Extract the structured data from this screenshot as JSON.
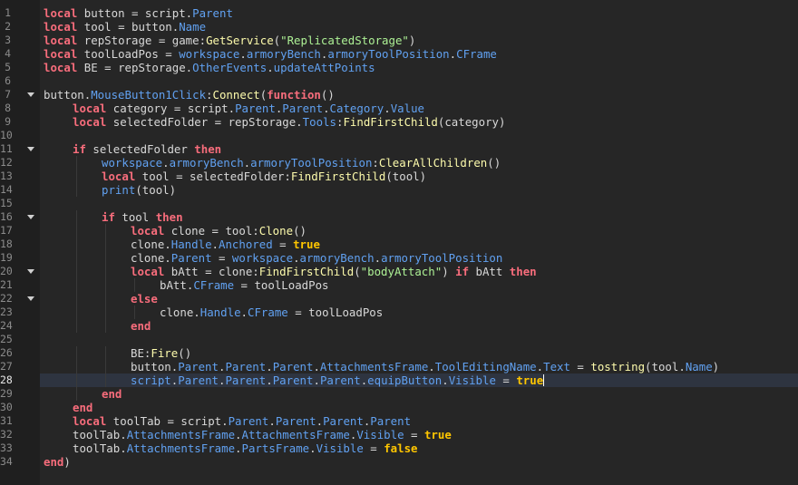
{
  "editor": {
    "current_line": 28,
    "colors": {
      "background": "#262626",
      "keyword": "#f86d7c",
      "property": "#61a1f1",
      "method": "#fdfbac",
      "string": "#adf195",
      "bool": "#ffc600",
      "text": "#d8d8d8"
    },
    "lines": [
      {
        "n": "1",
        "i": 0,
        "f": false,
        "segs": [
          [
            "k",
            "local"
          ],
          [
            "t",
            " button = script."
          ],
          [
            "p",
            "Parent"
          ]
        ]
      },
      {
        "n": "2",
        "i": 0,
        "f": false,
        "segs": [
          [
            "k",
            "local"
          ],
          [
            "t",
            " tool = button."
          ],
          [
            "p",
            "Name"
          ]
        ]
      },
      {
        "n": "3",
        "i": 0,
        "f": false,
        "segs": [
          [
            "k",
            "local"
          ],
          [
            "t",
            " repStorage = game:"
          ],
          [
            "m",
            "GetService"
          ],
          [
            "t",
            "("
          ],
          [
            "s",
            "\"ReplicatedStorage\""
          ],
          [
            "t",
            ")"
          ]
        ]
      },
      {
        "n": "4",
        "i": 0,
        "f": false,
        "segs": [
          [
            "k",
            "local"
          ],
          [
            "t",
            " toolLoadPos = "
          ],
          [
            "p",
            "workspace"
          ],
          [
            "t",
            "."
          ],
          [
            "p",
            "armoryBench"
          ],
          [
            "t",
            "."
          ],
          [
            "p",
            "armoryToolPosition"
          ],
          [
            "t",
            "."
          ],
          [
            "p",
            "CFrame"
          ]
        ]
      },
      {
        "n": "5",
        "i": 0,
        "f": false,
        "segs": [
          [
            "k",
            "local"
          ],
          [
            "t",
            " BE = repStorage."
          ],
          [
            "p",
            "OtherEvents"
          ],
          [
            "t",
            "."
          ],
          [
            "p",
            "updateAttPoints"
          ]
        ]
      },
      {
        "n": "6",
        "i": 0,
        "f": false,
        "segs": []
      },
      {
        "n": "7",
        "i": 0,
        "f": true,
        "segs": [
          [
            "t",
            "button."
          ],
          [
            "p",
            "MouseButton1Click"
          ],
          [
            "t",
            ":"
          ],
          [
            "m",
            "Connect"
          ],
          [
            "t",
            "("
          ],
          [
            "k",
            "function"
          ],
          [
            "t",
            "()"
          ]
        ]
      },
      {
        "n": "8",
        "i": 1,
        "f": false,
        "segs": [
          [
            "k",
            "local"
          ],
          [
            "t",
            " category = script."
          ],
          [
            "p",
            "Parent"
          ],
          [
            "t",
            "."
          ],
          [
            "p",
            "Parent"
          ],
          [
            "t",
            "."
          ],
          [
            "p",
            "Category"
          ],
          [
            "t",
            "."
          ],
          [
            "p",
            "Value"
          ]
        ]
      },
      {
        "n": "9",
        "i": 1,
        "f": false,
        "segs": [
          [
            "k",
            "local"
          ],
          [
            "t",
            " selectedFolder = repStorage."
          ],
          [
            "p",
            "Tools"
          ],
          [
            "t",
            ":"
          ],
          [
            "m",
            "FindFirstChild"
          ],
          [
            "t",
            "(category)"
          ]
        ]
      },
      {
        "n": "10",
        "i": 0,
        "f": false,
        "segs": []
      },
      {
        "n": "11",
        "i": 1,
        "f": true,
        "segs": [
          [
            "k",
            "if"
          ],
          [
            "t",
            " selectedFolder "
          ],
          [
            "k",
            "then"
          ]
        ]
      },
      {
        "n": "12",
        "i": 2,
        "f": false,
        "segs": [
          [
            "p",
            "workspace"
          ],
          [
            "t",
            "."
          ],
          [
            "p",
            "armoryBench"
          ],
          [
            "t",
            "."
          ],
          [
            "p",
            "armoryToolPosition"
          ],
          [
            "t",
            ":"
          ],
          [
            "m",
            "ClearAllChildren"
          ],
          [
            "t",
            "()"
          ]
        ]
      },
      {
        "n": "13",
        "i": 2,
        "f": false,
        "segs": [
          [
            "k",
            "local"
          ],
          [
            "t",
            " tool = selectedFolder:"
          ],
          [
            "m",
            "FindFirstChild"
          ],
          [
            "t",
            "(tool)"
          ]
        ]
      },
      {
        "n": "14",
        "i": 2,
        "f": false,
        "segs": [
          [
            "p",
            "print"
          ],
          [
            "t",
            "(tool)"
          ]
        ]
      },
      {
        "n": "15",
        "i": 0,
        "f": false,
        "segs": []
      },
      {
        "n": "16",
        "i": 2,
        "f": true,
        "segs": [
          [
            "k",
            "if"
          ],
          [
            "t",
            " tool "
          ],
          [
            "k",
            "then"
          ]
        ]
      },
      {
        "n": "17",
        "i": 3,
        "f": false,
        "segs": [
          [
            "k",
            "local"
          ],
          [
            "t",
            " clone = tool:"
          ],
          [
            "m",
            "Clone"
          ],
          [
            "t",
            "()"
          ]
        ]
      },
      {
        "n": "18",
        "i": 3,
        "f": false,
        "segs": [
          [
            "t",
            "clone."
          ],
          [
            "p",
            "Handle"
          ],
          [
            "t",
            "."
          ],
          [
            "p",
            "Anchored"
          ],
          [
            "t",
            " = "
          ],
          [
            "b",
            "true"
          ]
        ]
      },
      {
        "n": "19",
        "i": 3,
        "f": false,
        "segs": [
          [
            "t",
            "clone."
          ],
          [
            "p",
            "Parent"
          ],
          [
            "t",
            " = "
          ],
          [
            "p",
            "workspace"
          ],
          [
            "t",
            "."
          ],
          [
            "p",
            "armoryBench"
          ],
          [
            "t",
            "."
          ],
          [
            "p",
            "armoryToolPosition"
          ]
        ]
      },
      {
        "n": "20",
        "i": 3,
        "f": true,
        "segs": [
          [
            "k",
            "local"
          ],
          [
            "t",
            " bAtt = clone:"
          ],
          [
            "m",
            "FindFirstChild"
          ],
          [
            "t",
            "("
          ],
          [
            "s",
            "\"bodyAttach\""
          ],
          [
            "t",
            ") "
          ],
          [
            "k",
            "if"
          ],
          [
            "t",
            " bAtt "
          ],
          [
            "k",
            "then"
          ]
        ]
      },
      {
        "n": "21",
        "i": 4,
        "f": false,
        "segs": [
          [
            "t",
            "bAtt."
          ],
          [
            "p",
            "CFrame"
          ],
          [
            "t",
            " = toolLoadPos"
          ]
        ]
      },
      {
        "n": "22",
        "i": 3,
        "f": true,
        "segs": [
          [
            "k",
            "else"
          ]
        ]
      },
      {
        "n": "23",
        "i": 4,
        "f": false,
        "segs": [
          [
            "t",
            "clone."
          ],
          [
            "p",
            "Handle"
          ],
          [
            "t",
            "."
          ],
          [
            "p",
            "CFrame"
          ],
          [
            "t",
            " = toolLoadPos"
          ]
        ]
      },
      {
        "n": "24",
        "i": 3,
        "f": false,
        "segs": [
          [
            "k",
            "end"
          ]
        ]
      },
      {
        "n": "25",
        "i": 0,
        "f": false,
        "segs": []
      },
      {
        "n": "26",
        "i": 3,
        "f": false,
        "segs": [
          [
            "t",
            "BE:"
          ],
          [
            "m",
            "Fire"
          ],
          [
            "t",
            "()"
          ]
        ]
      },
      {
        "n": "27",
        "i": 3,
        "f": false,
        "segs": [
          [
            "t",
            "button."
          ],
          [
            "p",
            "Parent"
          ],
          [
            "t",
            "."
          ],
          [
            "p",
            "Parent"
          ],
          [
            "t",
            "."
          ],
          [
            "p",
            "Parent"
          ],
          [
            "t",
            "."
          ],
          [
            "p",
            "AttachmentsFrame"
          ],
          [
            "t",
            "."
          ],
          [
            "p",
            "ToolEditingName"
          ],
          [
            "t",
            "."
          ],
          [
            "p",
            "Text"
          ],
          [
            "t",
            " = "
          ],
          [
            "m",
            "tostring"
          ],
          [
            "t",
            "(tool."
          ],
          [
            "p",
            "Name"
          ],
          [
            "t",
            ")"
          ]
        ]
      },
      {
        "n": "28",
        "i": 3,
        "f": false,
        "segs": [
          [
            "p",
            "script"
          ],
          [
            "t",
            "."
          ],
          [
            "p",
            "Parent"
          ],
          [
            "t",
            "."
          ],
          [
            "p",
            "Parent"
          ],
          [
            "t",
            "."
          ],
          [
            "p",
            "Parent"
          ],
          [
            "t",
            "."
          ],
          [
            "p",
            "Parent"
          ],
          [
            "t",
            "."
          ],
          [
            "p",
            "equipButton"
          ],
          [
            "t",
            "."
          ],
          [
            "p",
            "Visible"
          ],
          [
            "t",
            " = "
          ],
          [
            "b",
            "true"
          ]
        ]
      },
      {
        "n": "29",
        "i": 2,
        "f": false,
        "segs": [
          [
            "k",
            "end"
          ]
        ]
      },
      {
        "n": "30",
        "i": 1,
        "f": false,
        "segs": [
          [
            "k",
            "end"
          ]
        ]
      },
      {
        "n": "31",
        "i": 1,
        "f": false,
        "segs": [
          [
            "k",
            "local"
          ],
          [
            "t",
            " toolTab = script."
          ],
          [
            "p",
            "Parent"
          ],
          [
            "t",
            "."
          ],
          [
            "p",
            "Parent"
          ],
          [
            "t",
            "."
          ],
          [
            "p",
            "Parent"
          ],
          [
            "t",
            "."
          ],
          [
            "p",
            "Parent"
          ]
        ]
      },
      {
        "n": "32",
        "i": 1,
        "f": false,
        "segs": [
          [
            "t",
            "toolTab."
          ],
          [
            "p",
            "AttachmentsFrame"
          ],
          [
            "t",
            "."
          ],
          [
            "p",
            "AttachmentsFrame"
          ],
          [
            "t",
            "."
          ],
          [
            "p",
            "Visible"
          ],
          [
            "t",
            " = "
          ],
          [
            "b",
            "true"
          ]
        ]
      },
      {
        "n": "33",
        "i": 1,
        "f": false,
        "segs": [
          [
            "t",
            "toolTab."
          ],
          [
            "p",
            "AttachmentsFrame"
          ],
          [
            "t",
            "."
          ],
          [
            "p",
            "PartsFrame"
          ],
          [
            "t",
            "."
          ],
          [
            "p",
            "Visible"
          ],
          [
            "t",
            " = "
          ],
          [
            "b",
            "false"
          ]
        ]
      },
      {
        "n": "34",
        "i": 0,
        "f": false,
        "segs": [
          [
            "k",
            "end"
          ],
          [
            "t",
            ")"
          ]
        ]
      }
    ]
  }
}
